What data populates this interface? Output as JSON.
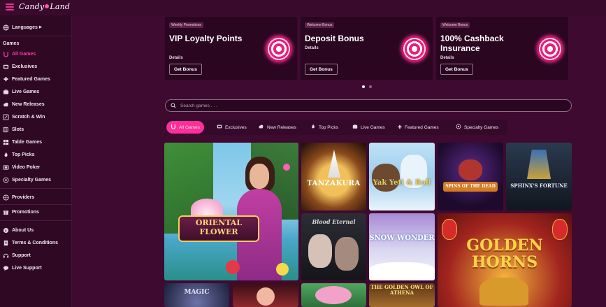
{
  "header": {
    "logo_text_1": "Candy",
    "logo_text_2": "Land"
  },
  "sidebar": {
    "languages": "Languages",
    "games_heading": "Games",
    "game_items": [
      {
        "label": "All Games",
        "icon": "candy-icon"
      },
      {
        "label": "Exclusives",
        "icon": "exclusive-icon"
      },
      {
        "label": "Featured Games",
        "icon": "puzzle-icon"
      },
      {
        "label": "Live Games",
        "icon": "live-icon"
      },
      {
        "label": "New Releases",
        "icon": "cloud-icon"
      },
      {
        "label": "Scratch & Win",
        "icon": "scratch-icon"
      },
      {
        "label": "Slots",
        "icon": "slots-icon"
      },
      {
        "label": "Table Games",
        "icon": "table-icon"
      },
      {
        "label": "Top Picks",
        "icon": "flame-icon"
      },
      {
        "label": "Video Poker",
        "icon": "poker-icon"
      },
      {
        "label": "Specialty Games",
        "icon": "specialty-icon"
      }
    ],
    "providers": "Providers",
    "promotions": "Promotions",
    "info_items": [
      {
        "label": "About Us",
        "icon": "info-icon"
      },
      {
        "label": "Terms & Conditions",
        "icon": "document-icon"
      },
      {
        "label": "Support",
        "icon": "support-icon"
      },
      {
        "label": "Live Support",
        "icon": "chat-icon"
      }
    ]
  },
  "promos": [
    {
      "tag": "Weekly Promotions",
      "title": "VIP Loyalty Points",
      "details": "Details",
      "button": "Get Bonus"
    },
    {
      "tag": "Welcome Bonus",
      "title": "Deposit Bonus",
      "details": "Details",
      "button": "Get Bonus"
    },
    {
      "tag": "Welcome Bonus",
      "title": "100% Cashback Insurance",
      "details": "Details",
      "button": "Get Bonus"
    }
  ],
  "search": {
    "placeholder": "Search games . . ."
  },
  "tabs": [
    {
      "label": "All Games",
      "icon": "candy-icon",
      "active": true
    },
    {
      "label": "Exclusives",
      "icon": "exclusive-icon"
    },
    {
      "label": "New Releases",
      "icon": "cloud-icon"
    },
    {
      "label": "Top Picks",
      "icon": "flame-icon"
    },
    {
      "label": "Live Games",
      "icon": "live-icon"
    },
    {
      "label": "Featured Games",
      "icon": "puzzle-icon"
    },
    {
      "label": "Specialty Games",
      "icon": "specialty-icon"
    }
  ],
  "games": [
    {
      "title": "ORIENTAL FLOWER"
    },
    {
      "title": "TANZAKURA"
    },
    {
      "title": "Yak Yeti & Roll"
    },
    {
      "title": "SPINS OF THE DEAD"
    },
    {
      "title": "SPHINX'S FORTUNE"
    },
    {
      "title": "Blood Eternal"
    },
    {
      "title": "SNOW WONDER"
    },
    {
      "title": "GOLDEN HORNS"
    },
    {
      "title": "MAGIC"
    },
    {
      "title": "THE GOLDEN OWL OF ATHENA"
    }
  ],
  "colors": {
    "accent": "#ff2e9a",
    "background": "#3e0a30",
    "sidebar": "#2f0824"
  }
}
